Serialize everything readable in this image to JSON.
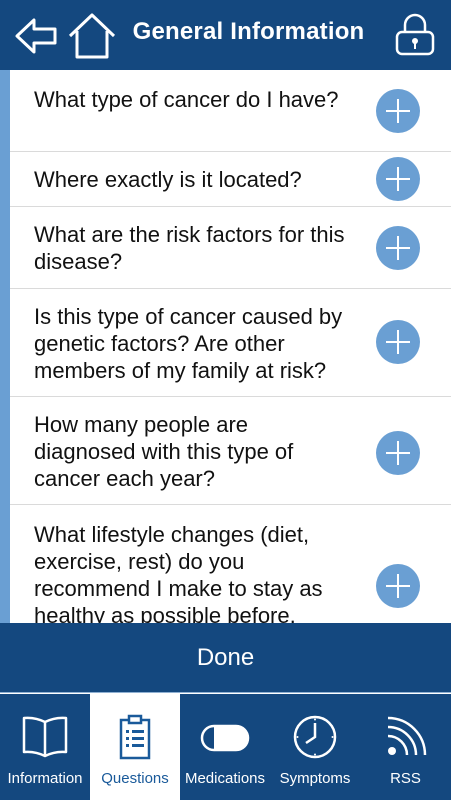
{
  "header": {
    "title": "General Information",
    "back_icon": "arrow-left-icon",
    "home_icon": "home-icon",
    "lock_icon": "lock-icon"
  },
  "questions": [
    {
      "text": "What type of cancer do I have?"
    },
    {
      "text": "Where exactly is it located?"
    },
    {
      "text": "What are the risk factors for this disease?"
    },
    {
      "text": "Is this type of cancer caused by genetic factors? Are other members of my family at risk?"
    },
    {
      "text": "How many people are diagnosed with this type of cancer each year?"
    },
    {
      "text": "What lifestyle changes (diet, exercise, rest) do you recommend I make to stay as healthy as possible before,"
    }
  ],
  "done_label": "Done",
  "tabs": [
    {
      "label": "Information",
      "icon": "book-icon",
      "active": false
    },
    {
      "label": "Questions",
      "icon": "clipboard-list-icon",
      "active": true
    },
    {
      "label": "Medications",
      "icon": "pill-icon",
      "active": false
    },
    {
      "label": "Symptoms",
      "icon": "clock-icon",
      "active": false
    },
    {
      "label": "RSS",
      "icon": "rss-icon",
      "active": false
    }
  ],
  "colors": {
    "primary": "#14487f",
    "accent": "#6a9fd3",
    "active_tab_text": "#1a5a9a"
  }
}
